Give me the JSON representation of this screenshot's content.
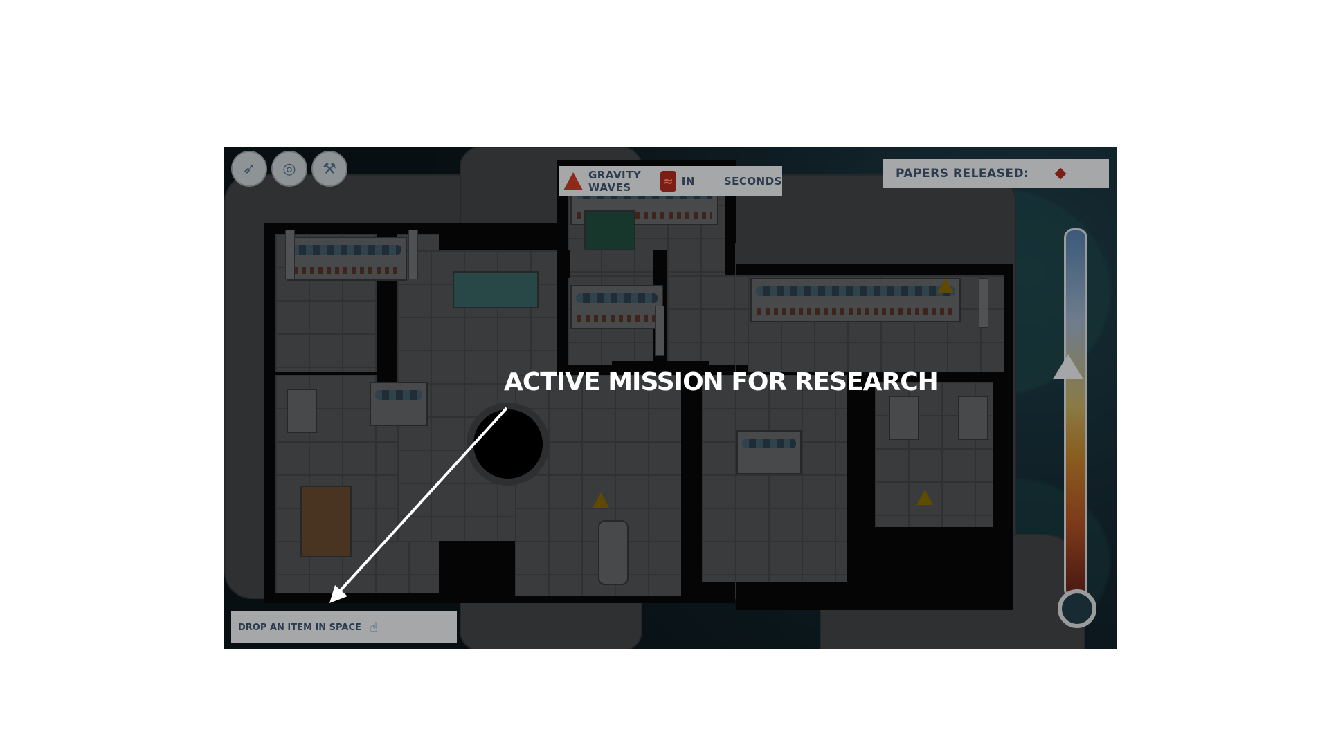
{
  "hud": {
    "top_left_buttons": [
      {
        "icon": "winged-boot-icon"
      },
      {
        "icon": "target-gear-icon"
      },
      {
        "icon": "hammer-bolt-icon"
      }
    ],
    "timer_banner": {
      "label": "Gravity waves",
      "in_label": "in",
      "seconds_label": "seconds",
      "alert_icon": "alert-triangle-icon",
      "wave_icon": "gravity-wave-icon"
    },
    "papers_banner": {
      "label": "Papers released:",
      "icon": "red-diamond-icon"
    },
    "mission": {
      "label": "Drop an item in space",
      "icon": "hand-drop-item-icon"
    }
  },
  "annotation": {
    "label": "Active mission for research",
    "color": "#ffffff"
  },
  "colors": {
    "banner_bg": "#a6a7a8",
    "banner_text": "#2c3b4e",
    "alert_red": "#8e2a1c"
  }
}
